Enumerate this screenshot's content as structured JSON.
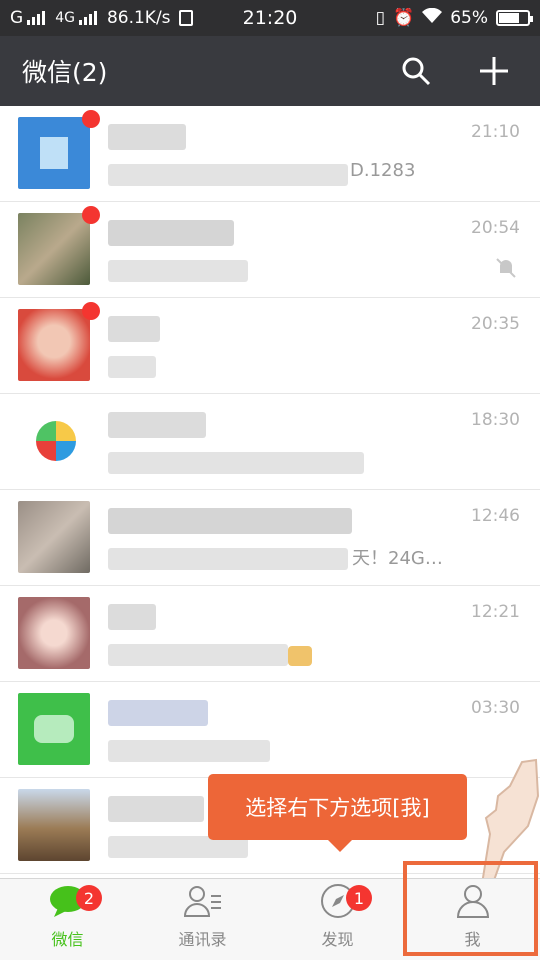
{
  "status_bar": {
    "carrier": "G",
    "network": "4G",
    "speed": "86.1K/s",
    "time": "21:20",
    "battery": "65%"
  },
  "header": {
    "title": "微信(2)",
    "search_icon": "search-icon",
    "add_icon": "plus-icon"
  },
  "chats": [
    {
      "time": "21:10",
      "preview_tail": "D.1283",
      "avatar_color": "#3b89d8",
      "unread": true
    },
    {
      "time": "20:54",
      "preview_tail": "",
      "avatar_color": "#7a8260",
      "unread": true,
      "muted": true
    },
    {
      "time": "20:35",
      "preview_tail": "",
      "avatar_color": "#d94a3d",
      "unread": true
    },
    {
      "time": "18:30",
      "preview_tail": "",
      "avatar_color": "#e9e9e9",
      "unread": false
    },
    {
      "time": "12:46",
      "preview_tail": "天！24G…",
      "avatar_color": "#9a8f86",
      "unread": false
    },
    {
      "time": "12:21",
      "preview_tail": "",
      "avatar_color": "#a56a6a",
      "unread": false
    },
    {
      "time": "03:30",
      "preview_tail": "",
      "avatar_color": "#3fbf4a",
      "unread": false
    },
    {
      "time": "",
      "preview_tail": "",
      "avatar_color": "#9b7b55",
      "unread": false
    }
  ],
  "tooltip": {
    "text": "选择右下方选项[我]"
  },
  "tabs": [
    {
      "label": "微信",
      "badge": "2",
      "active": true
    },
    {
      "label": "通讯录",
      "badge": "",
      "active": false
    },
    {
      "label": "发现",
      "badge": "1",
      "active": false
    },
    {
      "label": "我",
      "badge": "",
      "active": false
    }
  ],
  "colors": {
    "active": "#46c11b",
    "badge": "#f43530",
    "titlebar": "#393a3f",
    "accent": "#ed6638"
  }
}
